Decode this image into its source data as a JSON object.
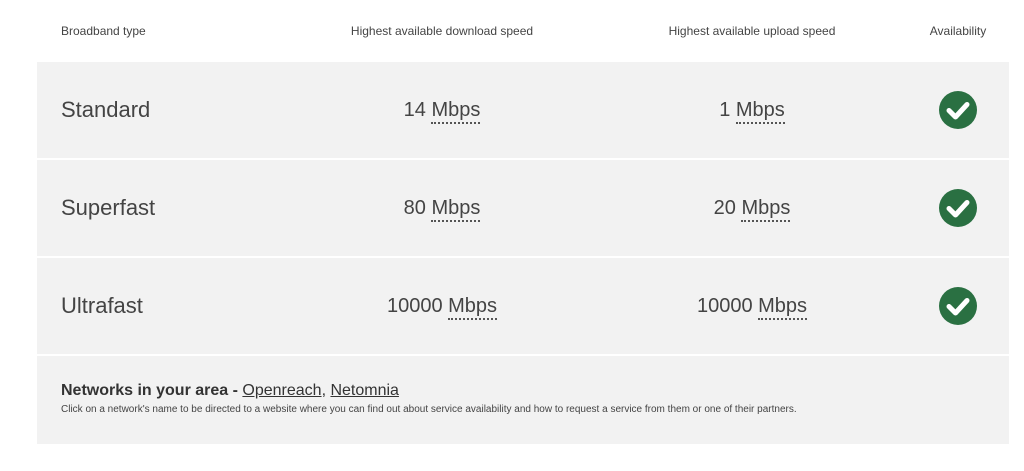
{
  "headers": {
    "type": "Broadband type",
    "download": "Highest available download speed",
    "upload": "Highest available upload speed",
    "availability": "Availability"
  },
  "rows": [
    {
      "type": "Standard",
      "download": "14",
      "upload": "1",
      "unit": "Mbps",
      "available": true
    },
    {
      "type": "Superfast",
      "download": "80",
      "upload": "20",
      "unit": "Mbps",
      "available": true
    },
    {
      "type": "Ultrafast",
      "download": "10000",
      "upload": "10000",
      "unit": "Mbps",
      "available": true
    }
  ],
  "networks": {
    "title": "Networks in your area -",
    "links": [
      "Openreach",
      "Netomnia"
    ],
    "note": "Click on a network's name to be directed to a website where you can find out about service availability and how to request a service from them or one of their partners."
  },
  "colors": {
    "row_bg": "#f2f2f2",
    "check": "#2a7042"
  },
  "icons": {
    "available": "check-circle-icon"
  }
}
